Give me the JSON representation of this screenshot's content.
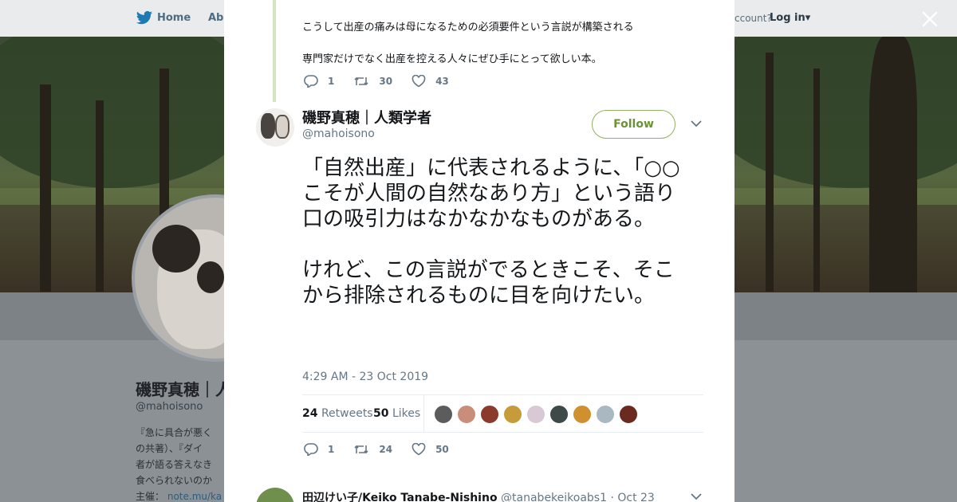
{
  "nav": {
    "home": "Home",
    "about": "Abo",
    "have_account": "ccount?",
    "login": "Log in"
  },
  "profile": {
    "name": "磯野真穂｜人",
    "handle": "@mahoisono",
    "bio_lines": [
      "『急に具合が悪く",
      "の共著）、『ダイ",
      "者が語る答えなき",
      "食べられないのか"
    ],
    "bio_label": "主催：",
    "bio_link": "note.mu/ka"
  },
  "previous_tweet": {
    "line1": "こうして出産の痛みは母になるための必須要件という言説が構築される",
    "line2": "専門家だけでなく出産を控える人々にぜひ手にとって欲しい本。",
    "replies": "1",
    "retweets": "30",
    "likes": "43"
  },
  "tweet": {
    "author_name": "磯野真穂｜人類学者",
    "author_handle": "@mahoisono",
    "follow_label": "Follow",
    "paragraph1": "「自然出産」に代表されるように、「○○こそが人間の自然なあり方」という語り口の吸引力はなかなかなものがある。",
    "paragraph2": "けれど、この言説がでるときこそ、そこから排除されるものに目を向けたい。",
    "timestamp": "4:29 AM - 23 Oct 2019",
    "retweet_count": "24",
    "retweet_label": "Retweets",
    "like_count": "50",
    "like_label": "Likes",
    "replies": "1",
    "retweets": "24",
    "likes": "50"
  },
  "reply": {
    "name": "田辺けい子/Keiko Tanabe-Nishino",
    "handle": "@tanabekeikoabs1",
    "date": "· Oct 23"
  },
  "colors": {
    "follow_accent": "#6b9335",
    "thread_line": "#d2e6c1",
    "muted_text": "#657786"
  },
  "icons": [
    "twitter-bird-icon",
    "close-icon",
    "reply-icon",
    "retweet-icon",
    "heart-icon",
    "chevron-down-icon"
  ]
}
